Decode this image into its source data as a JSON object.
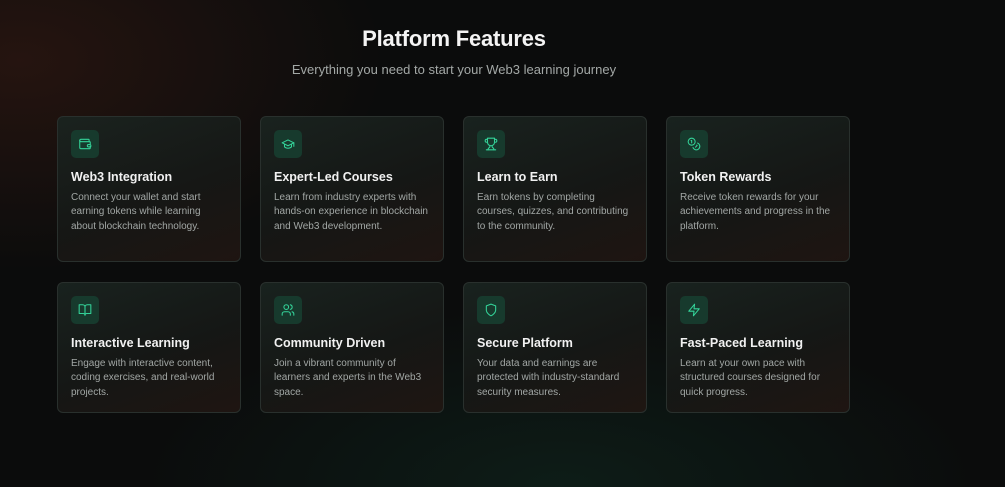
{
  "section": {
    "title": "Platform Features",
    "subtitle": "Everything you need to start your Web3 learning journey"
  },
  "features": [
    {
      "icon": "wallet-icon",
      "title": "Web3 Integration",
      "description": "Connect your wallet and start earning tokens while learning about blockchain technology."
    },
    {
      "icon": "graduation-cap-icon",
      "title": "Expert-Led Courses",
      "description": "Learn from industry experts with hands-on experience in blockchain and Web3 development."
    },
    {
      "icon": "trophy-icon",
      "title": "Learn to Earn",
      "description": "Earn tokens by completing courses, quizzes, and contributing to the community."
    },
    {
      "icon": "coins-icon",
      "title": "Token Rewards",
      "description": "Receive token rewards for your achievements and progress in the platform."
    },
    {
      "icon": "book-open-icon",
      "title": "Interactive Learning",
      "description": "Engage with interactive content, coding exercises, and real-world projects."
    },
    {
      "icon": "users-icon",
      "title": "Community Driven",
      "description": "Join a vibrant community of learners and experts in the Web3 space."
    },
    {
      "icon": "shield-icon",
      "title": "Secure Platform",
      "description": "Your data and earnings are protected with industry-standard security measures."
    },
    {
      "icon": "lightning-icon",
      "title": "Fast-Paced Learning",
      "description": "Learn at your own pace with structured courses designed for quick progress."
    }
  ],
  "colors": {
    "accent": "#34d399",
    "icon_background": "#173a2d",
    "page_background": "#0b0c0c"
  }
}
